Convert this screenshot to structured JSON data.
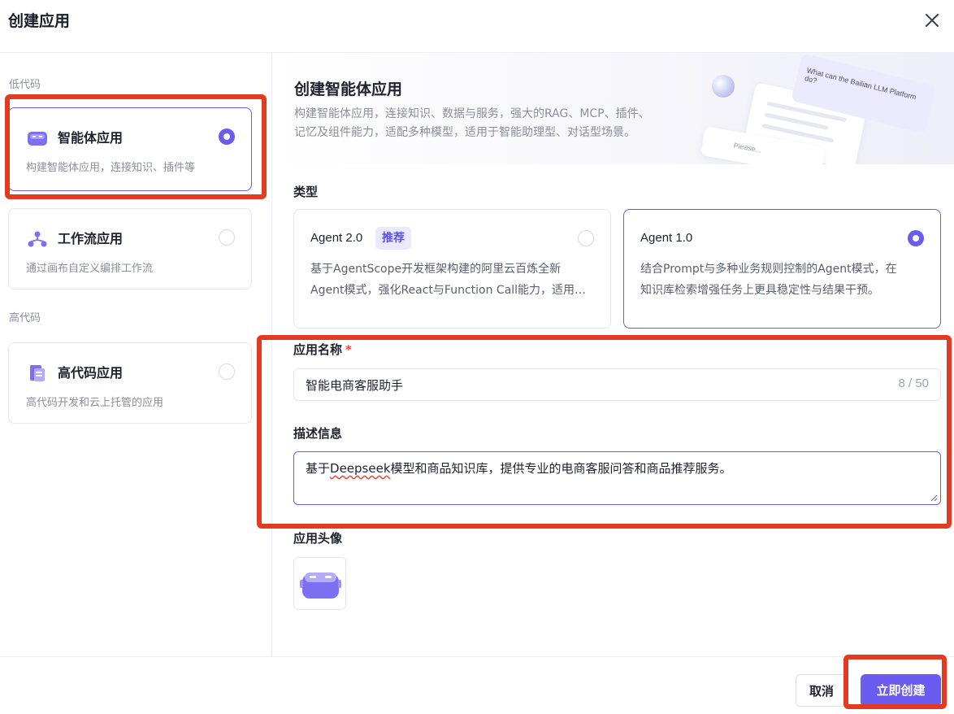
{
  "dialog": {
    "title": "创建应用"
  },
  "sidebar": {
    "low_code_label": "低代码",
    "high_code_label": "高代码",
    "items": [
      {
        "title": "智能体应用",
        "desc": "构建智能体应用，连接知识、插件等",
        "selected": true,
        "icon": "robot-icon"
      },
      {
        "title": "工作流应用",
        "desc": "通过画布自定义编排工作流",
        "selected": false,
        "icon": "workflow-icon"
      },
      {
        "title": "高代码应用",
        "desc": "高代码开发和云上托管的应用",
        "selected": false,
        "icon": "document-icon"
      }
    ]
  },
  "banner": {
    "title": "创建智能体应用",
    "desc_line1": "构建智能体应用，连接知识、数据与服务，强大的RAG、MCP、插件、",
    "desc_line2": "记忆及组件能力，适配多种模型，适用于智能助理型、对话型场景。",
    "illustration_bubble": "What can the Bailian LLM Platform do?",
    "illustration_input": "Please..."
  },
  "type_section": {
    "label": "类型",
    "options": [
      {
        "name": "Agent 2.0",
        "badge": "推荐",
        "desc_line1": "基于AgentScope开发框架构建的阿里云百炼全新",
        "desc_line2": "Agent模式，强化React与Function Call能力，适用…",
        "selected": false
      },
      {
        "name": "Agent 1.0",
        "desc_line1": "结合Prompt与多种业务规则控制的Agent模式，在",
        "desc_line2": "知识库检索增强任务上更具稳定性与结果干预。",
        "selected": true
      }
    ]
  },
  "form": {
    "name_label": "应用名称",
    "required_mark": "*",
    "name_value": "智能电商客服助手",
    "name_count": "8 / 50",
    "desc_label": "描述信息",
    "desc_prefix": "基于",
    "desc_misspelled": "Deepseek",
    "desc_suffix": "模型和商品知识库，提供专业的电商客服问答和商品推荐服务。",
    "avatar_label": "应用头像"
  },
  "footer": {
    "cancel_label": "取消",
    "create_label": "立即创建"
  },
  "colors": {
    "accent": "#6a5cf0",
    "highlight": "#e23b22",
    "badge_bg": "#ebe9ff"
  }
}
